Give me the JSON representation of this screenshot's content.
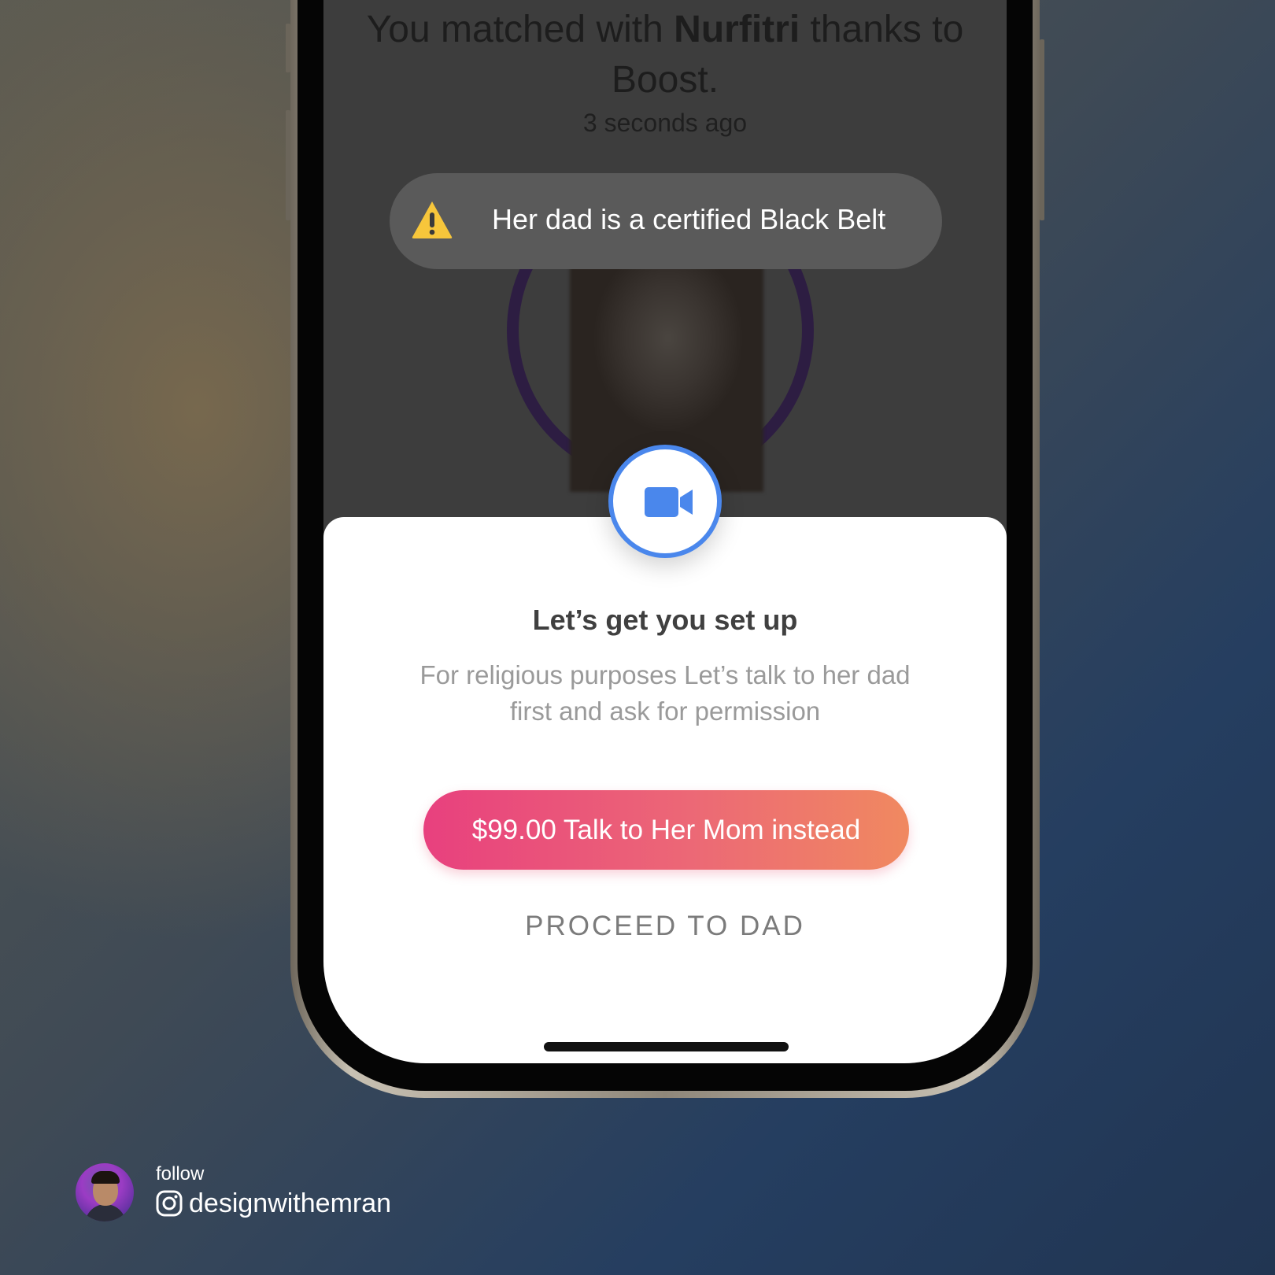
{
  "match_header": {
    "title_prefix": "You matched with",
    "match_name": "Nurfitri",
    "title_suffix": "thanks to Boost.",
    "timestamp": "3 seconds ago"
  },
  "toast": {
    "icon": "warning-icon",
    "message": "Her dad is a certified Black Belt"
  },
  "sheet": {
    "icon": "video-camera-icon",
    "title": "Let’s get you set up",
    "description_line1": "For religious purposes Let’s talk to her dad",
    "description_line2": "first and ask for permission",
    "primary_button_label": "$99.00 Talk to Her Mom instead",
    "secondary_button_label": "PROCEED TO DAD"
  },
  "credit": {
    "follow_label": "follow",
    "handle": "designwithemran",
    "icon": "instagram-icon"
  },
  "colors": {
    "accent_blue": "#4a87ec",
    "gradient_start": "#e8407e",
    "gradient_end": "#f08960",
    "warning_yellow": "#f7c63b"
  }
}
